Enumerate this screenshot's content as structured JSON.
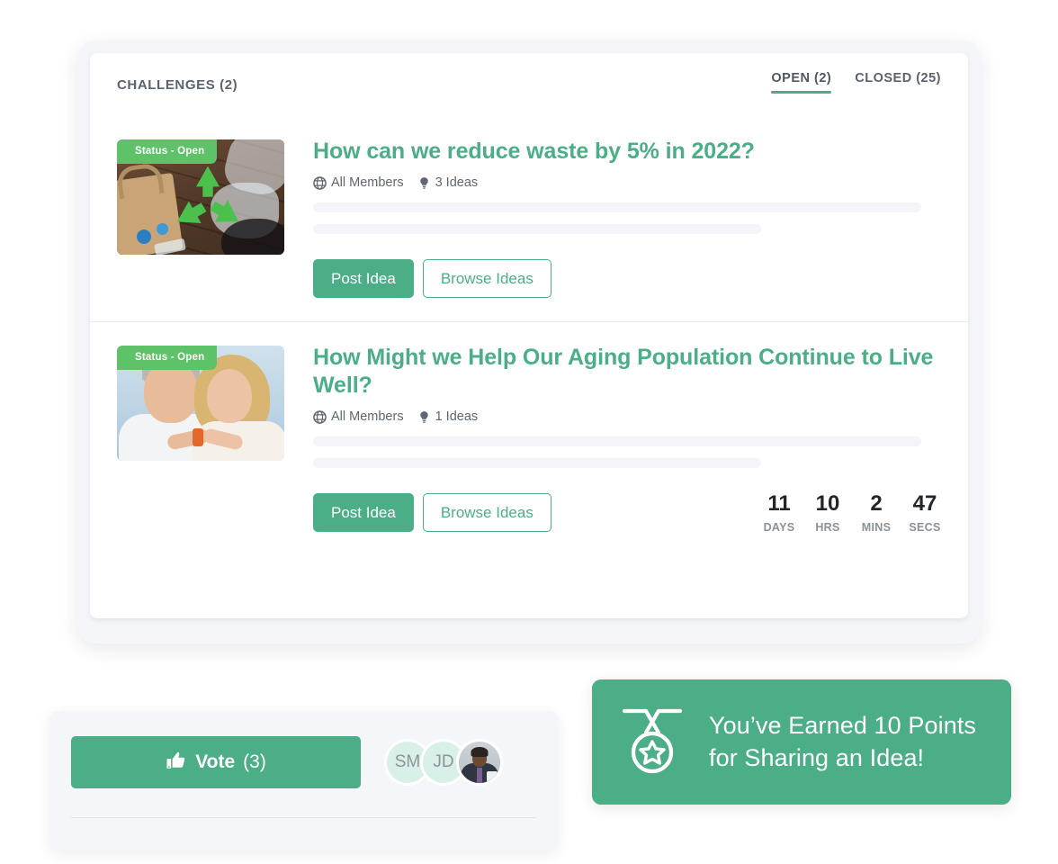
{
  "challenges_panel": {
    "title": "CHALLENGES (2)",
    "tabs": [
      {
        "label": "OPEN (2)",
        "active": true
      },
      {
        "label": "CLOSED (25)",
        "active": false
      }
    ],
    "accent_color": "#4bae87",
    "badge_color": "#5ec269",
    "items": [
      {
        "status_badge": "Status - Open",
        "title": "How can we reduce waste by 5% in 2022?",
        "audience": "All Members",
        "ideas": "3 Ideas",
        "post_button": "Post Idea",
        "browse_button": "Browse Ideas",
        "thumbnail": "recycling-symbol-on-wood-with-plastic-waste"
      },
      {
        "status_badge": "Status - Open",
        "title": "How Might we Help Our Aging Population Continue to Live Well?",
        "audience": "All Members",
        "ideas": "1 Ideas",
        "post_button": "Post Idea",
        "browse_button": "Browse Ideas",
        "thumbnail": "older-couple-holding-keys",
        "countdown": [
          {
            "value": "11",
            "label": "DAYS"
          },
          {
            "value": "10",
            "label": "HRS"
          },
          {
            "value": "2",
            "label": "MINS"
          },
          {
            "value": "47",
            "label": "SECS"
          }
        ]
      }
    ]
  },
  "vote_card": {
    "button_label": "Vote",
    "button_count": "(3)",
    "avatars": [
      {
        "initials": "SM",
        "type": "initials"
      },
      {
        "initials": "JD",
        "type": "initials"
      },
      {
        "initials": "",
        "type": "photo"
      }
    ]
  },
  "points_toast": {
    "line1": "You’ve Earned 10 Points",
    "line2": "for Sharing an Idea!",
    "icon": "medal-star-icon",
    "background_color": "#4bae87"
  }
}
